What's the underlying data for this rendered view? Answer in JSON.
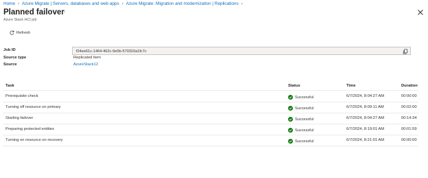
{
  "breadcrumb": [
    "Home",
    "Azure Migrate | Servers, databases and web apps",
    "Azure Migrate: Migration and modernization | Replications"
  ],
  "header": {
    "title": "Planned failover",
    "more_label": "···",
    "subtitle": "Azure Stack HCI job"
  },
  "toolbar": {
    "refresh_label": "Refresh"
  },
  "properties": {
    "job_id_label": "Job ID",
    "job_id_value": "f24ee61c-1464-462c-9e5b-570310a1fc7c",
    "source_type_label": "Source type",
    "source_type_value": "Replicated item",
    "source_label": "Source",
    "source_value": "AzureStack12"
  },
  "table": {
    "columns": [
      "Task",
      "Status",
      "Time",
      "Duration"
    ],
    "rows": [
      {
        "task": "Prerequisite check",
        "status": "Successful",
        "time": "6/7/2024, 8:04:27 AM",
        "duration": "00:00:00"
      },
      {
        "task": "Turning off resource on primary",
        "status": "Successful",
        "time": "6/7/2024, 8:09:11 AM",
        "duration": "00:02:00"
      },
      {
        "task": "Starting failover",
        "status": "Successful",
        "time": "6/7/2024, 8:04:27 AM",
        "duration": "00:14:34"
      },
      {
        "task": "Preparing protected entities",
        "status": "Successful",
        "time": "6/7/2024, 8:19:01 AM",
        "duration": "00:01:59"
      },
      {
        "task": "Turning on resource on recovery",
        "status": "Successful",
        "time": "6/7/2024, 8:21:01 AM",
        "duration": "00:00:00"
      }
    ]
  },
  "colors": {
    "link": "#0f6cbd",
    "success": "#107c10"
  },
  "icons": {
    "close": "close-icon",
    "refresh": "refresh-icon",
    "copy": "copy-icon",
    "status": "success-check-icon"
  }
}
